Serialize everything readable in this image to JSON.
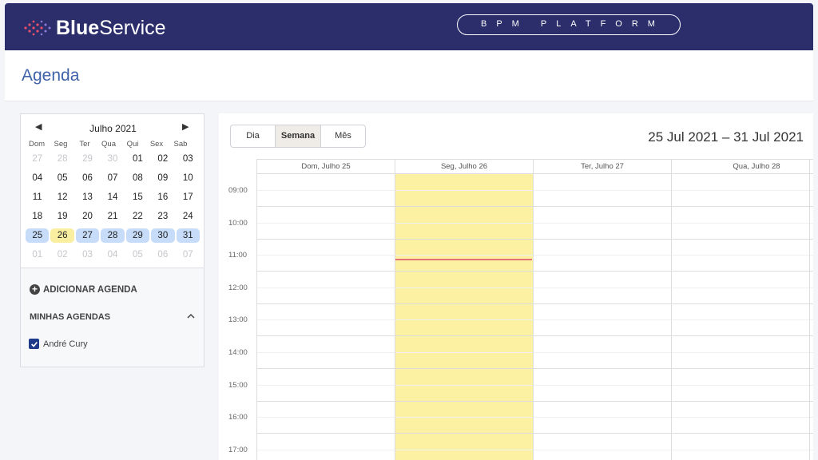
{
  "header": {
    "logo_bold": "Blue",
    "logo_light": "Service",
    "platform_badge": "BPM PLATFORM",
    "logo_icon": "dots-logo-icon",
    "brand_color": "#2b2e6b"
  },
  "page": {
    "title": "Agenda"
  },
  "mini_calendar": {
    "title": "Julho 2021",
    "prev_icon": "triangle-left-icon",
    "next_icon": "triangle-right-icon",
    "weekdays": [
      "Dom",
      "Seg",
      "Ter",
      "Qua",
      "Qui",
      "Sex",
      "Sab"
    ],
    "weeks": [
      [
        "27",
        "28",
        "29",
        "30",
        "01",
        "02",
        "03"
      ],
      [
        "04",
        "05",
        "06",
        "07",
        "08",
        "09",
        "10"
      ],
      [
        "11",
        "12",
        "13",
        "14",
        "15",
        "16",
        "17"
      ],
      [
        "18",
        "19",
        "20",
        "21",
        "22",
        "23",
        "24"
      ],
      [
        "25",
        "26",
        "27",
        "28",
        "29",
        "30",
        "31"
      ],
      [
        "01",
        "02",
        "03",
        "04",
        "05",
        "06",
        "07"
      ]
    ],
    "selected_week": 4,
    "today_col": 1,
    "other_month": [
      [
        0,
        1,
        2,
        3
      ],
      [],
      [],
      [],
      [],
      [
        0,
        1,
        2,
        3,
        4,
        5,
        6
      ]
    ]
  },
  "sidebar": {
    "add_label": "ADICIONAR AGENDA",
    "my_calendars_title": "MINHAS AGENDAS",
    "calendars": [
      {
        "label": "André Cury",
        "checked": true
      }
    ]
  },
  "calendar": {
    "views": [
      "Dia",
      "Semana",
      "Mês"
    ],
    "active_view": "Semana",
    "range_label": "25 Jul 2021 – 31 Jul 2021",
    "day_headers": [
      "Dom, Julho 25",
      "Seg, Julho 26",
      "Ter, Julho 27",
      "Qua, Julho 28"
    ],
    "times": [
      "09:00",
      "10:00",
      "11:00",
      "12:00",
      "13:00",
      "14:00",
      "15:00",
      "16:00",
      "17:00"
    ],
    "today_highlight_color": "#fcf0a3",
    "now_line_color": "#e57373"
  }
}
